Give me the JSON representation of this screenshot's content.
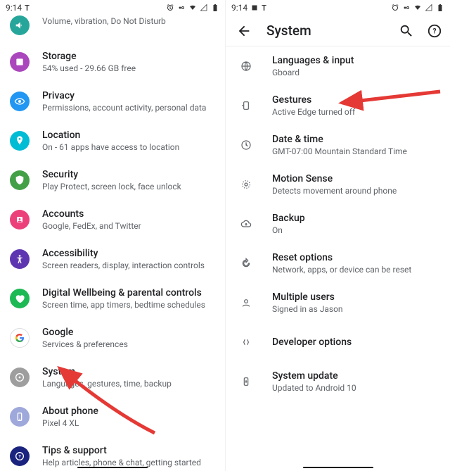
{
  "statusbar": {
    "time": "9:14"
  },
  "left": {
    "items": [
      {
        "title": "Sound",
        "sub": "Volume, vibration, Do Not Disturb"
      },
      {
        "title": "Storage",
        "sub": "54% used - 29.66 GB free"
      },
      {
        "title": "Privacy",
        "sub": "Permissions, account activity, personal data"
      },
      {
        "title": "Location",
        "sub": "On - 61 apps have access to location"
      },
      {
        "title": "Security",
        "sub": "Play Protect, screen lock, face unlock"
      },
      {
        "title": "Accounts",
        "sub": "Google, FedEx, and Twitter"
      },
      {
        "title": "Accessibility",
        "sub": "Screen readers, display, interaction controls"
      },
      {
        "title": "Digital Wellbeing & parental controls",
        "sub": "Screen time, app timers, bedtime schedules"
      },
      {
        "title": "Google",
        "sub": "Services & preferences"
      },
      {
        "title": "System",
        "sub": "Languages, gestures, time, backup"
      },
      {
        "title": "About phone",
        "sub": "Pixel 4 XL"
      },
      {
        "title": "Tips & support",
        "sub": "Help articles, phone & chat, getting started"
      }
    ]
  },
  "right": {
    "title": "System",
    "items": [
      {
        "title": "Languages & input",
        "sub": "Gboard"
      },
      {
        "title": "Gestures",
        "sub": "Active Edge turned off"
      },
      {
        "title": "Date & time",
        "sub": "GMT-07:00 Mountain Standard Time"
      },
      {
        "title": "Motion Sense",
        "sub": "Detects movement around phone"
      },
      {
        "title": "Backup",
        "sub": "On"
      },
      {
        "title": "Reset options",
        "sub": "Network, apps, or device can be reset"
      },
      {
        "title": "Multiple users",
        "sub": "Signed in as Jason"
      },
      {
        "title": "Developer options",
        "sub": ""
      },
      {
        "title": "System update",
        "sub": "Updated to Android 10"
      }
    ]
  }
}
